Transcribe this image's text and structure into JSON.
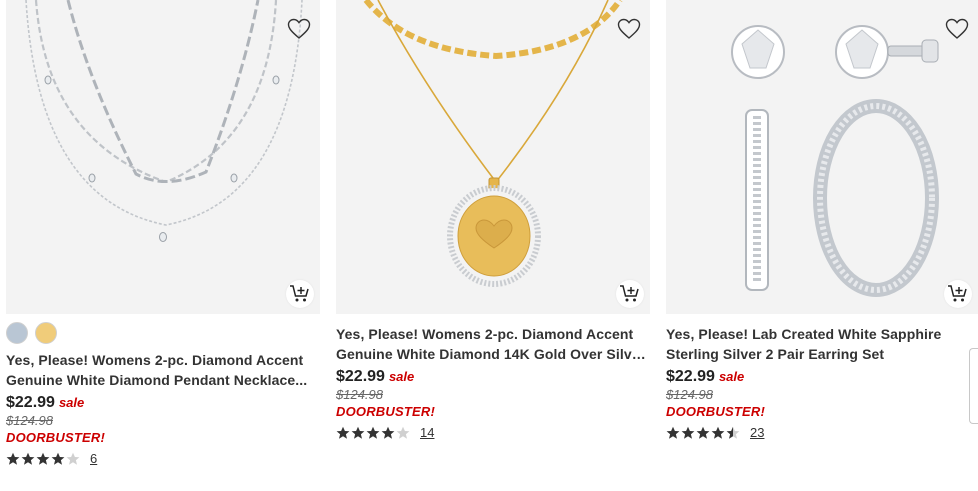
{
  "products": [
    {
      "title_line1": "Yes, Please! Womens 2-pc. Diamond Accent",
      "title_line2": "Genuine White Diamond Pendant Necklace...",
      "price": "$22.99",
      "sale_label": "sale",
      "original_price": "$124.98",
      "promo": "DOORBUSTER!",
      "rating": 4,
      "review_count": "6",
      "swatches": [
        "#b9c6d4",
        "#f0cc7a"
      ],
      "image": "silver-layered-necklace"
    },
    {
      "title_line1": "Yes, Please! Womens 2-pc. Diamond Accent",
      "title_line2": "Genuine White Diamond 14K Gold Over Silve...",
      "price": "$22.99",
      "sale_label": "sale",
      "original_price": "$124.98",
      "promo": "DOORBUSTER!",
      "rating": 4,
      "review_count": "14",
      "image": "gold-heart-pendant-necklace"
    },
    {
      "title_line1": "Yes, Please! Lab Created White Sapphire",
      "title_line2": "Sterling Silver 2 Pair Earring Set",
      "price": "$22.99",
      "sale_label": "sale",
      "original_price": "$124.98",
      "promo": "DOORBUSTER!",
      "rating": 4.5,
      "review_count": "23",
      "image": "silver-earring-set"
    }
  ],
  "icons": {
    "favorite": "heart-outline-icon",
    "add_to_cart": "cart-plus-icon",
    "rating": "star-icon"
  },
  "colors": {
    "sale_red": "#cc0000",
    "star": "#333333",
    "star_empty": "#d0d0d0",
    "image_bg": "#f3f3f3"
  }
}
